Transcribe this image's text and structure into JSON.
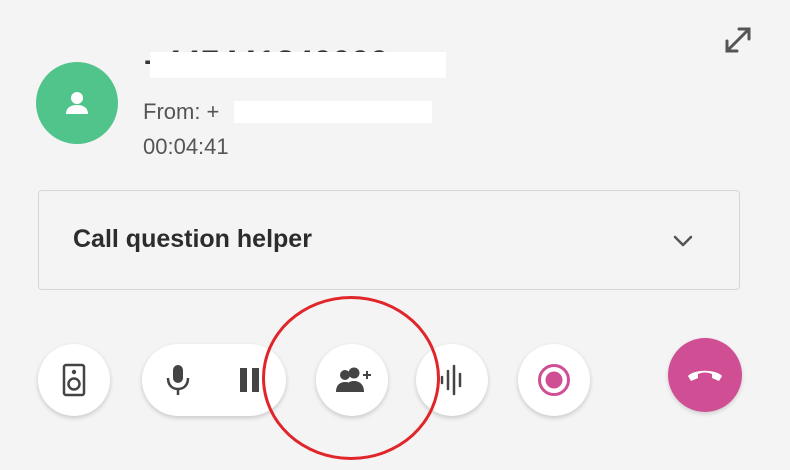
{
  "call": {
    "number": "+447441849999",
    "from_label": "From: +",
    "duration": "00:04:41"
  },
  "helper": {
    "label": "Call question helper"
  },
  "colors": {
    "avatar_bg": "#51c48c",
    "hangup_bg": "#d04f94",
    "record_color": "#d04f94",
    "annotation": "#e0262b"
  },
  "icons": [
    "expand-icon",
    "person-icon",
    "chevron-down-icon",
    "speaker-icon",
    "microphone-icon",
    "pause-icon",
    "add-participant-icon",
    "audio-wave-icon",
    "record-icon",
    "phone-hangup-icon"
  ]
}
